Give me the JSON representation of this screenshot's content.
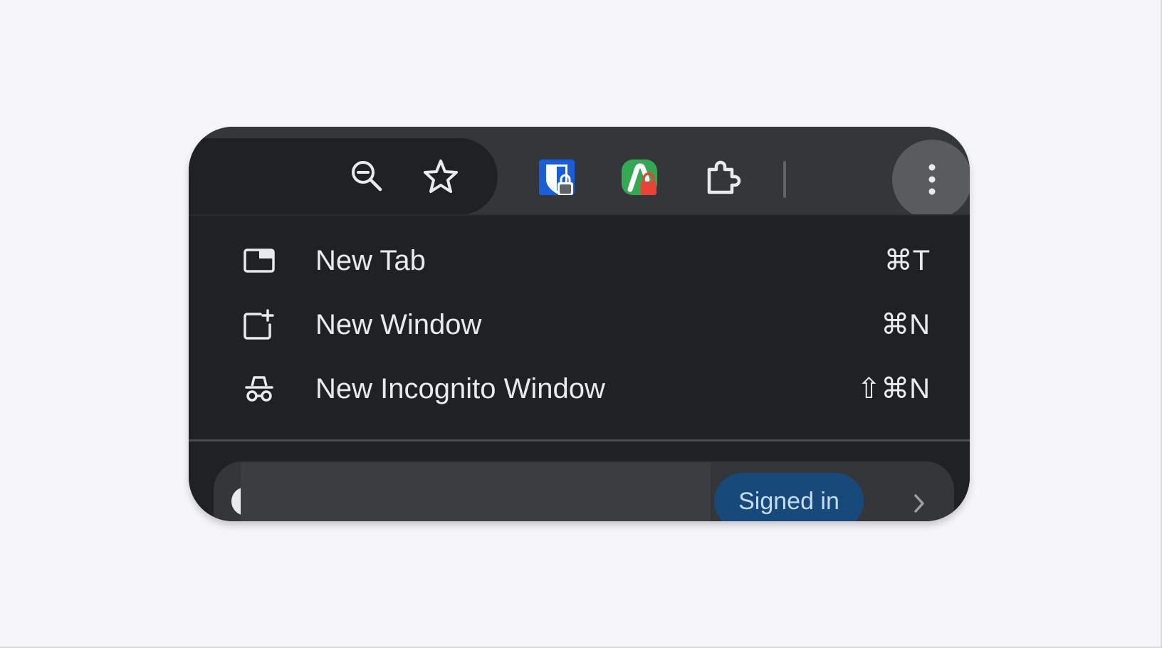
{
  "toolbar": {
    "icons": [
      "zoom-out-icon",
      "star-icon",
      "bitwarden-icon",
      "extension-icon",
      "puzzle-icon",
      "more-vert-icon"
    ]
  },
  "menu": {
    "items": [
      {
        "label": "New Tab",
        "shortcut": "⌘T",
        "icon": "new-tab-icon"
      },
      {
        "label": "New Window",
        "shortcut": "⌘N",
        "icon": "new-window-icon"
      },
      {
        "label": "New Incognito Window",
        "shortcut": "⇧⌘N",
        "icon": "incognito-icon"
      }
    ]
  },
  "profile": {
    "status": "Signed in"
  },
  "colors": {
    "background": "#f5f5fa",
    "toolbar": "#35363a",
    "menu": "#202124",
    "text": "#e8eaed",
    "bitwarden": "#175ddc",
    "extension_green": "#34a853",
    "badge": "#174a7a"
  }
}
